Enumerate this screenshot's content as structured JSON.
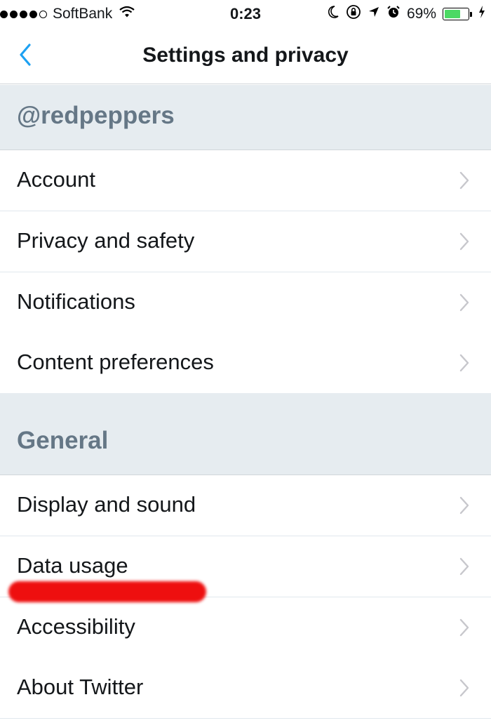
{
  "status_bar": {
    "carrier": "SoftBank",
    "time": "0:23",
    "battery_percent": "69%",
    "battery_level": 0.69
  },
  "nav": {
    "title": "Settings and privacy"
  },
  "sections": [
    {
      "header": "@redpeppers",
      "items": [
        "Account",
        "Privacy and safety",
        "Notifications",
        "Content preferences"
      ]
    },
    {
      "header": "General",
      "items": [
        "Display and sound",
        "Data usage",
        "Accessibility",
        "About Twitter"
      ]
    }
  ],
  "colors": {
    "accent": "#1da1f2",
    "section_bg": "#e6ecf0",
    "section_text": "#657786",
    "annotation_red": "#ee0f0f"
  }
}
